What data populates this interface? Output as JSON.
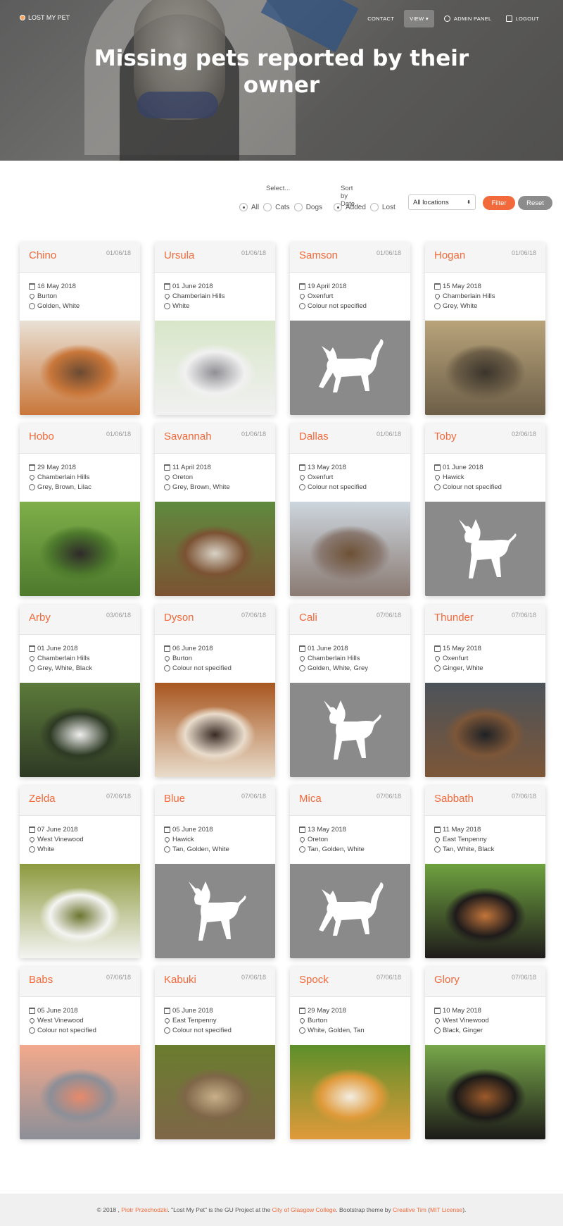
{
  "nav": {
    "brand": "LOST MY PET",
    "links": [
      {
        "label": "CONTACT",
        "icon": ""
      },
      {
        "label": "VIEW ▾",
        "icon": ""
      },
      {
        "label": "ADMIN PANEL",
        "icon": "gear-icon"
      },
      {
        "label": "LOGOUT",
        "icon": "share-icon"
      }
    ]
  },
  "hero": {
    "title": "Missing pets reported by their owner"
  },
  "filters": {
    "select_label": "Select...",
    "type_options": [
      "All",
      "Cats",
      "Dogs"
    ],
    "type_selected": "All",
    "sort_label": "Sort by Date...",
    "sort_options": [
      "Added",
      "Lost"
    ],
    "sort_selected": "Added",
    "location": "All locations",
    "filter_button": "Filter",
    "reset_button": "Reset"
  },
  "pets": [
    {
      "name": "Chino",
      "date": "01/06/18",
      "lost": "16 May 2018",
      "location": "Burton",
      "colour": "Golden, White",
      "photo": "dog-photo",
      "palette": [
        "#e9e1d6",
        "#c9773a",
        "#6b4a33"
      ]
    },
    {
      "name": "Ursula",
      "date": "01/06/18",
      "lost": "01 June 2018",
      "location": "Chamberlain Hills",
      "colour": "White",
      "photo": "cat-photo",
      "palette": [
        "#d8e6c9",
        "#f1f1f1",
        "#8f8f95"
      ]
    },
    {
      "name": "Samson",
      "date": "01/06/18",
      "lost": "19 April 2018",
      "location": "Oxenfurt",
      "colour": "Colour not specified",
      "photo": "cat-placeholder-icon"
    },
    {
      "name": "Hogan",
      "date": "01/06/18",
      "lost": "15 May 2018",
      "location": "Chamberlain Hills",
      "colour": "Grey, White",
      "photo": "dog-photo",
      "palette": [
        "#b8a37a",
        "#6d5f48",
        "#3c352c"
      ]
    },
    {
      "name": "Hobo",
      "date": "01/06/18",
      "lost": "29 May 2018",
      "location": "Chamberlain Hills",
      "colour": "Grey, Brown, Lilac",
      "photo": "dog-photo",
      "palette": [
        "#7fae4a",
        "#4d7a2c",
        "#2f2a2a"
      ]
    },
    {
      "name": "Savannah",
      "date": "01/06/18",
      "lost": "11 April 2018",
      "location": "Oreton",
      "colour": "Grey, Brown, White",
      "photo": "cat-photo",
      "palette": [
        "#5f8a3e",
        "#7b5233",
        "#d8d2c6"
      ]
    },
    {
      "name": "Dallas",
      "date": "01/06/18",
      "lost": "13 May 2018",
      "location": "Oxenfurt",
      "colour": "Colour not specified",
      "photo": "cat-photo",
      "palette": [
        "#cdd6de",
        "#8a7a72",
        "#6d5135"
      ]
    },
    {
      "name": "Toby",
      "date": "02/06/18",
      "lost": "01 June 2018",
      "location": "Hawick",
      "colour": "Colour not specified",
      "photo": "dog-placeholder-icon"
    },
    {
      "name": "Arby",
      "date": "03/06/18",
      "lost": "01 June 2018",
      "location": "Chamberlain Hills",
      "colour": "Grey, White, Black",
      "photo": "dog-photo",
      "palette": [
        "#5c7a3a",
        "#2e3a24",
        "#efefef"
      ]
    },
    {
      "name": "Dyson",
      "date": "07/06/18",
      "lost": "06 June 2018",
      "location": "Burton",
      "colour": "Colour not specified",
      "photo": "cat-photo",
      "palette": [
        "#a8561f",
        "#e9dccb",
        "#3a2b25"
      ]
    },
    {
      "name": "Cali",
      "date": "07/06/18",
      "lost": "01 June 2018",
      "location": "Chamberlain Hills",
      "colour": "Golden, White, Grey",
      "photo": "dog-placeholder-icon"
    },
    {
      "name": "Thunder",
      "date": "07/06/18",
      "lost": "15 May 2018",
      "location": "Oxenfurt",
      "colour": "Ginger, White",
      "photo": "cat-photo",
      "palette": [
        "#4c535a",
        "#7c5638",
        "#1f2226"
      ]
    },
    {
      "name": "Zelda",
      "date": "07/06/18",
      "lost": "07 June 2018",
      "location": "West Vinewood",
      "colour": "White",
      "photo": "dog-photo",
      "palette": [
        "#8d9a3e",
        "#f4f4f2",
        "#6d7530"
      ]
    },
    {
      "name": "Blue",
      "date": "07/06/18",
      "lost": "05 June 2018",
      "location": "Hawick",
      "colour": "Tan, Golden, White",
      "photo": "dog-placeholder-icon"
    },
    {
      "name": "Mica",
      "date": "07/06/18",
      "lost": "13 May 2018",
      "location": "Oreton",
      "colour": "Tan, Golden, White",
      "photo": "cat-placeholder-icon"
    },
    {
      "name": "Sabbath",
      "date": "07/06/18",
      "lost": "11 May 2018",
      "location": "East Tenpenny",
      "colour": "Tan, White, Black",
      "photo": "dog-photo",
      "palette": [
        "#6ea23f",
        "#1f1b1b",
        "#c2753a"
      ]
    },
    {
      "name": "Babs",
      "date": "07/06/18",
      "lost": "05 June 2018",
      "location": "West Vinewood",
      "colour": "Colour not specified",
      "photo": "cat-photo",
      "palette": [
        "#f3a98c",
        "#8c8f98",
        "#e88a6b"
      ]
    },
    {
      "name": "Kabuki",
      "date": "07/06/18",
      "lost": "05 June 2018",
      "location": "East Tenpenny",
      "colour": "Colour not specified",
      "photo": "cat-photo",
      "palette": [
        "#6a7d2e",
        "#7e6648",
        "#c9b08a"
      ]
    },
    {
      "name": "Spock",
      "date": "07/06/18",
      "lost": "29 May 2018",
      "location": "Burton",
      "colour": "White, Golden, Tan",
      "photo": "cat-photo",
      "palette": [
        "#5c8f2a",
        "#e09a3a",
        "#f2ede2"
      ]
    },
    {
      "name": "Glory",
      "date": "07/06/18",
      "lost": "10 May 2018",
      "location": "West Vinewood",
      "colour": "Black, Ginger",
      "photo": "dog-photo",
      "palette": [
        "#78a84a",
        "#1c1a18",
        "#9c5a2a"
      ]
    }
  ],
  "footer": {
    "prefix": "© 2018 , ",
    "author": "Piotr Przechodzki",
    "mid1": ". \"Lost My Pet\" is the GU Project at the ",
    "college": "City of Glasgow College",
    "mid2": ". Bootstrap theme by ",
    "theme": "Creative Tim",
    "mid3": " (",
    "license": "MIT License",
    "suffix": ")."
  },
  "colors": {
    "accent": "#f26a3b",
    "reset": "#8c8c8c",
    "placeholder_bg": "#8a8a8a"
  }
}
